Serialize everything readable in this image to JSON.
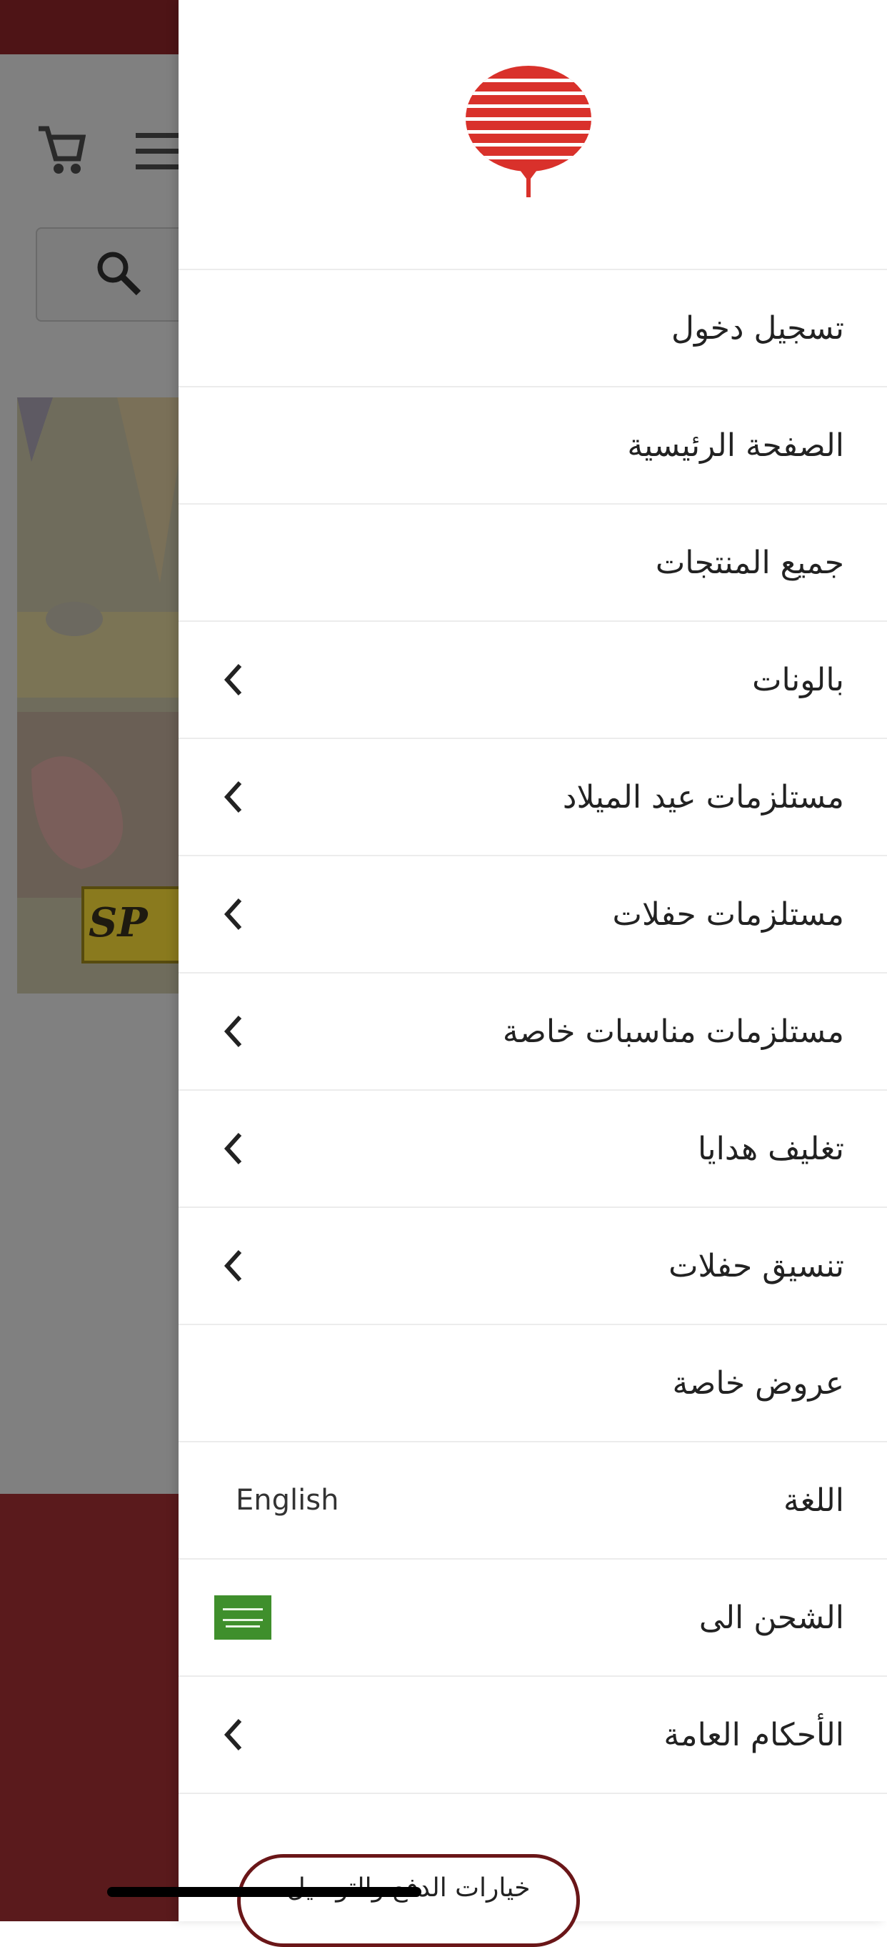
{
  "background": {
    "banner_text": "SP",
    "icons": [
      "cart-icon",
      "hamburger-menu-icon",
      "search-icon"
    ]
  },
  "drawer": {
    "logo": "balloon-logo",
    "menu": [
      {
        "label": "تسجيل دخول",
        "chevron": false
      },
      {
        "label": "الصفحة الرئيسية",
        "chevron": false
      },
      {
        "label": "جميع المنتجات",
        "chevron": false
      },
      {
        "label": "بالونات",
        "chevron": true
      },
      {
        "label": "مستلزمات عيد الميلاد",
        "chevron": true
      },
      {
        "label": "مستلزمات حفلات",
        "chevron": true
      },
      {
        "label": "مستلزمات مناسبات خاصة",
        "chevron": true
      },
      {
        "label": "تغليف هدايا",
        "chevron": true
      },
      {
        "label": "تنسيق حفلات",
        "chevron": true
      },
      {
        "label": "عروض خاصة",
        "chevron": false
      },
      {
        "label": "اللغة",
        "value": "English"
      },
      {
        "label": "الشحن الى",
        "value_icon": "saudi-flag-icon"
      },
      {
        "label": "الأحكام العامة",
        "chevron": true
      }
    ],
    "bottom_button": "خيارات الدفع والتوصيل"
  },
  "colors": {
    "brand_red": "#d9312b",
    "dark_maroon": "#5a1a1c",
    "flag_green": "#3f8f2c"
  }
}
